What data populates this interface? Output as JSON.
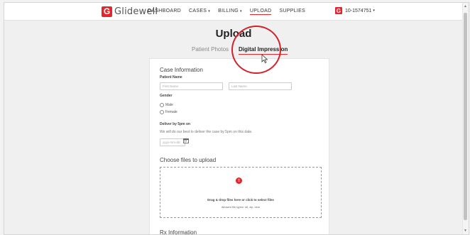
{
  "brand": {
    "logo_letter": "G",
    "name": "Glidewell",
    "color": "#e1262d"
  },
  "nav": {
    "items": [
      {
        "label": "DASHBOARD"
      },
      {
        "label": "CASES",
        "caret": "▾"
      },
      {
        "label": "BILLING",
        "caret": "▾"
      },
      {
        "label": "UPLOAD",
        "active": true
      },
      {
        "label": "SUPPLIES"
      }
    ]
  },
  "account": {
    "logo_letter": "G",
    "id": "10-1574751",
    "caret": "▾"
  },
  "page": {
    "title": "Upload"
  },
  "tabs": {
    "patient_photos": "Patient Photos",
    "digital_impression": "Digital Impression",
    "active": "digital_impression"
  },
  "case_info": {
    "heading": "Case Information",
    "patient_name_label": "Patient Name",
    "first_name_placeholder": "First Name",
    "last_name_placeholder": "Last Name",
    "gender_label": "Gender",
    "gender_options": [
      "Male",
      "Female"
    ],
    "deliver_label": "Deliver by 5pm on",
    "deliver_note": "We will do our best to deliver the case by 5pm on this date.",
    "date_placeholder": "yyyy-mm-dd"
  },
  "upload": {
    "heading": "Choose files to upload",
    "drop_text": "Drag & drop files here or click to select files",
    "allowed_text": "Allowed file types: stl, zip, dcm"
  },
  "rx": {
    "heading": "Rx Information"
  },
  "icons": {
    "upload": "upload-icon",
    "calendar": "calendar-icon",
    "cursor": "mouse-pointer-icon"
  }
}
